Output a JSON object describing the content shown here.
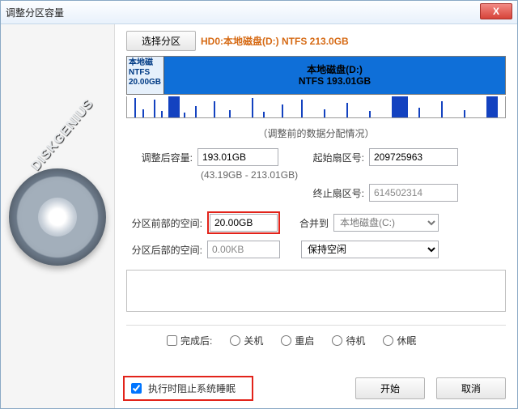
{
  "window": {
    "title": "调整分区容量"
  },
  "close_icon": "X",
  "toolbar": {
    "select_partition": "选择分区",
    "hd0_line": "HD0:本地磁盘(D:) NTFS 213.0GB"
  },
  "partbar": {
    "left": {
      "l1": "本地磁",
      "l2": "NTFS",
      "l3": "20.00GB"
    },
    "right": {
      "l1": "本地磁盘(D:)",
      "l2": "NTFS 193.01GB"
    }
  },
  "caption": "（调整前的数据分配情况）",
  "fields": {
    "size_after_label": "调整后容量:",
    "size_after_value": "193.01GB",
    "range": "(43.19GB - 213.01GB)",
    "start_sector_label": "起始扇区号:",
    "start_sector_value": "209725963",
    "end_sector_label": "终止扇区号:",
    "end_sector_value": "614502314",
    "space_before_label": "分区前部的空间:",
    "space_before_value": "20.00GB",
    "merge_label": "合并到",
    "merge_value": "本地磁盘(C:)",
    "space_after_label": "分区后部的空间:",
    "space_after_value": "0.00KB",
    "keep_free_label": "保持空闲"
  },
  "after": {
    "label": "完成后:",
    "shutdown": "关机",
    "reboot": "重启",
    "standby": "待机",
    "hibernate": "休眠"
  },
  "footer": {
    "prevent_sleep": "执行时阻止系统睡眠",
    "start": "开始",
    "cancel": "取消"
  },
  "brand": "DISKGENIUS"
}
